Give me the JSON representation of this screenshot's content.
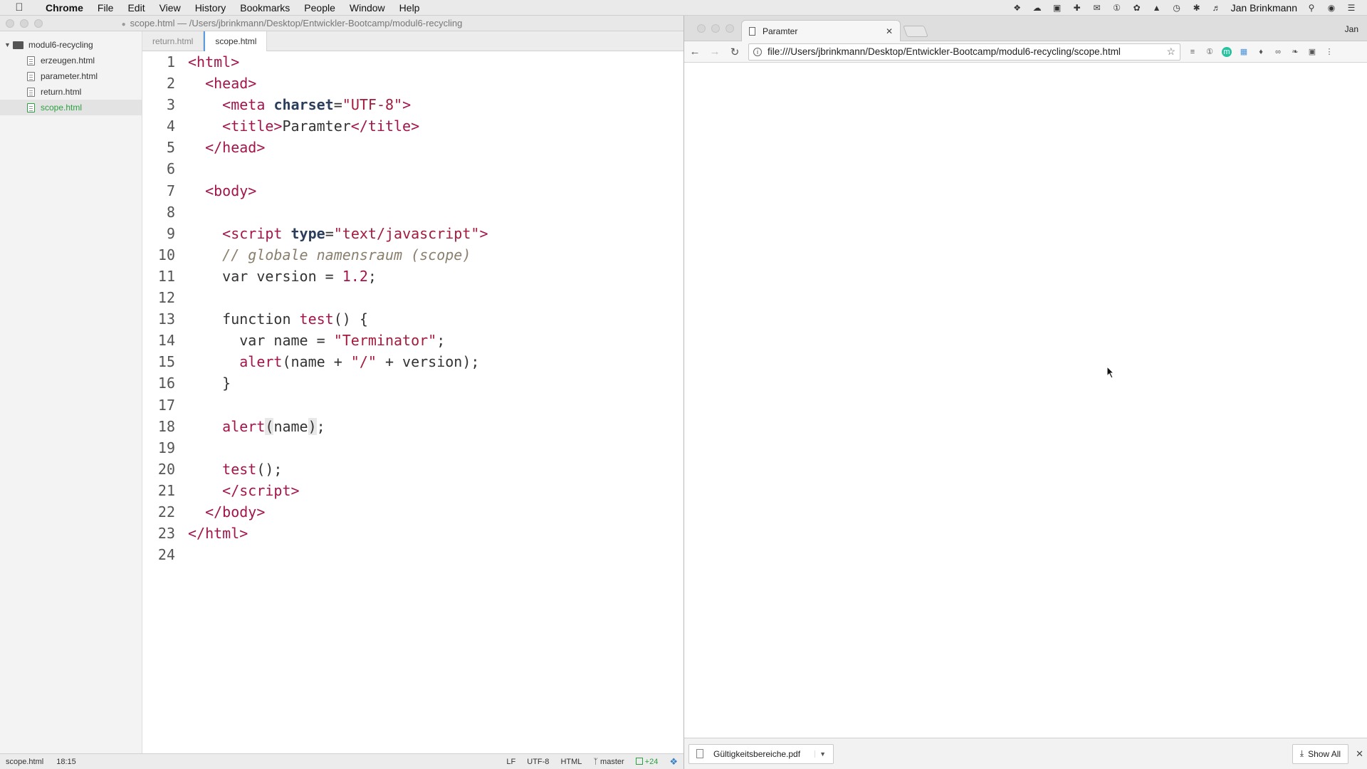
{
  "menubar": {
    "app_name": "Chrome",
    "items": [
      "File",
      "Edit",
      "View",
      "History",
      "Bookmarks",
      "People",
      "Window",
      "Help"
    ],
    "user_name": "Jan Brinkmann"
  },
  "editor": {
    "window_title": "scope.html — /Users/jbrinkmann/Desktop/Entwickler-Bootcamp/modul6-recycling",
    "tree": {
      "folder": "modul6-recycling",
      "files": [
        "erzeugen.html",
        "parameter.html",
        "return.html",
        "scope.html"
      ],
      "active_file": "scope.html"
    },
    "tabs": [
      "return.html",
      "scope.html"
    ],
    "active_tab": "scope.html",
    "line_numbers": [
      "1",
      "2",
      "3",
      "4",
      "5",
      "6",
      "7",
      "8",
      "9",
      "10",
      "11",
      "12",
      "13",
      "14",
      "15",
      "16",
      "17",
      "18",
      "19",
      "20",
      "21",
      "22",
      "23",
      "24"
    ],
    "status": {
      "file": "scope.html",
      "cursor": "18:15",
      "line_ending": "LF",
      "encoding": "UTF-8",
      "grammar": "HTML",
      "branch": "master",
      "git_changes": "+24"
    }
  },
  "chrome": {
    "tab_title": "Paramter",
    "profile": "Jan",
    "url": "file:///Users/jbrinkmann/Desktop/Entwickler-Bootcamp/modul6-recycling/scope.html",
    "download_file": "Gültigkeitsbereiche.pdf",
    "show_all_label": "Show All"
  }
}
